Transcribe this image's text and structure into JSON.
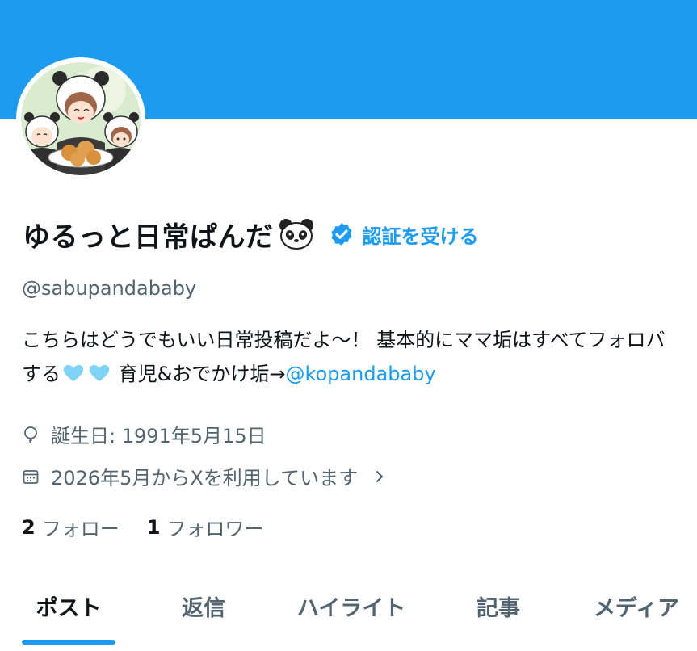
{
  "colors": {
    "banner": "#1d9bf0",
    "accent": "#1d9bf0",
    "text": "#0f1419",
    "muted": "#536471"
  },
  "profile": {
    "display_name": "ゆるっと日常ぱんだ",
    "verify_link": "認証を受ける",
    "handle": "@sabupandababy",
    "bio_part1": "こちらはどうでもいい日常投稿だよ〜！ 基本的にママ垢はすべてフォロバする",
    "bio_part2": " 育児&おでかけ垢→",
    "bio_mention": "@kopandababy",
    "birthday": "誕生日: 1991年5月15日",
    "joined": "2026年5月からXを利用しています"
  },
  "stats": {
    "following_count": "2",
    "following_label": "フォロー",
    "followers_count": "1",
    "followers_label": "フォロワー"
  },
  "tabs": [
    {
      "label": "ポスト",
      "active": true
    },
    {
      "label": "返信"
    },
    {
      "label": "ハイライト"
    },
    {
      "label": "記事"
    },
    {
      "label": "メディア"
    }
  ],
  "icons": [
    "panda-emoji-icon",
    "verified-badge-icon",
    "light-blue-heart-icon",
    "balloon-icon",
    "calendar-icon",
    "chevron-right-icon"
  ]
}
